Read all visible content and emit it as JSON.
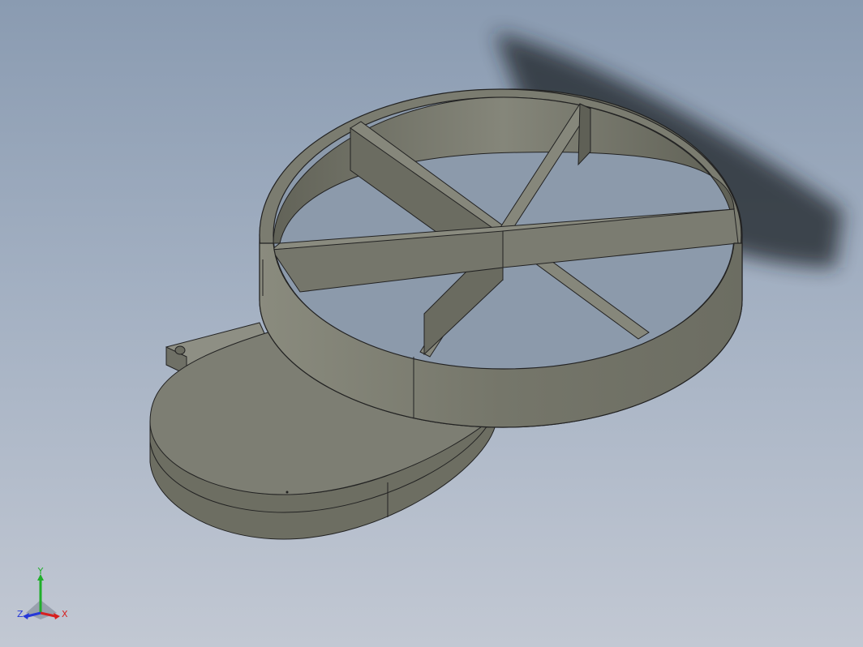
{
  "viewport": {
    "background_top": "#8a9bb1",
    "background_bottom": "#c2c8d3",
    "part_color": "#7b7c6f"
  },
  "triad": {
    "x_label": "X",
    "y_label": "Y",
    "z_label": "Z",
    "x_color": "#d62020",
    "y_color": "#1fae2a",
    "z_color": "#2638d8"
  }
}
